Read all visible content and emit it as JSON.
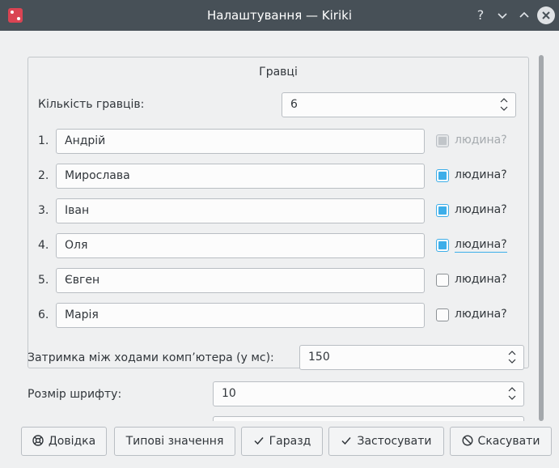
{
  "window": {
    "title": "Налаштування — Kiriki",
    "help_glyph": "?",
    "minimize_glyph": "⌄",
    "maximize_glyph": "⌃",
    "close_glyph": "✕"
  },
  "players_group": {
    "title": "Гравці",
    "count_label": "Кількість гравців:",
    "count_value": "6",
    "human_label": "людина?",
    "players": [
      {
        "num": "1.",
        "name": "Андрій",
        "human": "disabled"
      },
      {
        "num": "2.",
        "name": "Мирослава",
        "human": "checked"
      },
      {
        "num": "3.",
        "name": "Іван",
        "human": "checked"
      },
      {
        "num": "4.",
        "name": "Оля",
        "human": "checked"
      },
      {
        "num": "5.",
        "name": "Євген",
        "human": "unchecked"
      },
      {
        "num": "6.",
        "name": "Марія",
        "human": "unchecked"
      }
    ]
  },
  "delay": {
    "label": "Затримка між ходами комп’ютера (у мс):",
    "value": "150"
  },
  "font_size": {
    "label": "Розмір шрифту:",
    "value": "10"
  },
  "buttons": {
    "help": "Довідка",
    "defaults": "Типові значення",
    "ok": "Гаразд",
    "apply": "Застосувати",
    "cancel": "Скасувати"
  },
  "colors": {
    "accent": "#3daee9",
    "titlebar": "#475057"
  }
}
